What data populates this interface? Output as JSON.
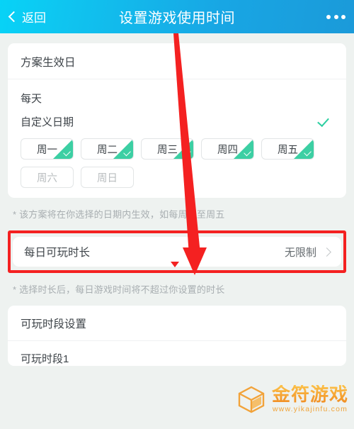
{
  "header": {
    "back_label": "返回",
    "title": "设置游戏使用时间",
    "more_icon": "more-horizontal-icon",
    "gradient_start": "#07d3f7",
    "gradient_end": "#1b9ad9"
  },
  "effective_card": {
    "title": "方案生效日",
    "everyday_label": "每天",
    "custom_label": "自定义日期",
    "custom_selected": true,
    "check_color": "#2ccfa1",
    "days": [
      {
        "label": "周一",
        "selected": true
      },
      {
        "label": "周二",
        "selected": true
      },
      {
        "label": "周三",
        "selected": true
      },
      {
        "label": "周四",
        "selected": true
      },
      {
        "label": "周五",
        "selected": true
      },
      {
        "label": "周六",
        "selected": false
      },
      {
        "label": "周日",
        "selected": false
      }
    ],
    "note": "* 该方案将在你选择的日期内生效，如每周一至周五"
  },
  "duration_row": {
    "label": "每日可玩时长",
    "value": "无限制",
    "chevron_icon": "chevron-right-icon",
    "highlight_color": "#f42121",
    "note": "* 选择时长后，每日游戏时间将不超过你设置的时长"
  },
  "period_card": {
    "title": "可玩时段设置",
    "first_item": "可玩时段1"
  },
  "annotation": {
    "arrow_color": "#f42121",
    "arrow_icon": "red-arrow-down-icon",
    "marker_icon": "red-triangle-marker-icon"
  },
  "watermark": {
    "brand": "金符游戏",
    "url": "www.yikajinfu.com",
    "logo_icon": "cube-logo-icon",
    "color": "#f2972a"
  }
}
